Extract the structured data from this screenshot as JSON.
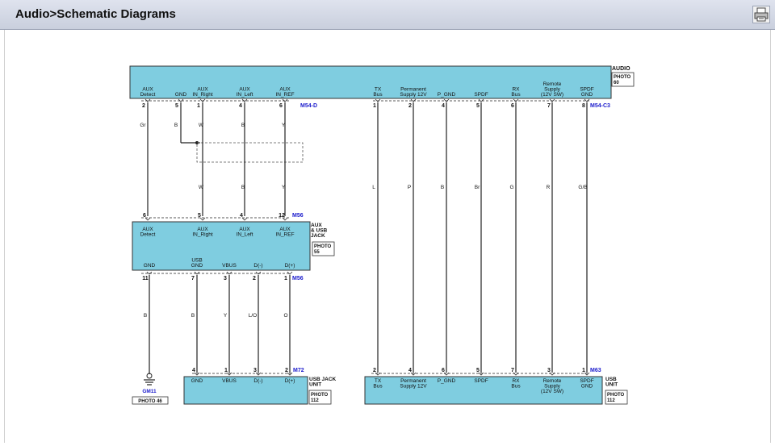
{
  "header": {
    "title": "Audio>Schematic Diagrams",
    "print_icon": "printer-icon"
  },
  "colors": {
    "connector_fill": "#7fcde0",
    "wire": "#222222",
    "connector_id": "#1a1acc"
  },
  "diagram": {
    "top_component": {
      "name": "AUDIO",
      "photo": "PHOTO\n60",
      "pins_left": [
        {
          "label": "AUX\nDetect",
          "num": "2"
        },
        {
          "label": "GND",
          "num": "5"
        },
        {
          "label": "AUX\nIN_Right",
          "num": "1"
        },
        {
          "label": "AUX\nIN_Left",
          "num": "4"
        },
        {
          "label": "AUX\nIN_REF",
          "num": "6"
        }
      ],
      "connector_left": "M54-D",
      "pins_right": [
        {
          "label": "TX\nBus",
          "num": "1"
        },
        {
          "label": "Permanent\nSupply 12V",
          "num": "2"
        },
        {
          "label": "P_GND",
          "num": "4"
        },
        {
          "label": "SPDF",
          "num": "5"
        },
        {
          "label": "RX\nBus",
          "num": "6"
        },
        {
          "label": "Remote\nSupply\n(12V SW)",
          "num": "7"
        },
        {
          "label": "SPDF\nGND",
          "num": "8"
        }
      ],
      "connector_right": "M54-C3"
    },
    "wires_top_left": {
      "upper_colors": [
        "Gr",
        "B",
        "W",
        "B",
        "Y"
      ],
      "lower_colors": [
        "W",
        "B",
        "Y"
      ]
    },
    "wires_right": [
      "L",
      "P",
      "B",
      "Br",
      "G",
      "R",
      "G/B"
    ],
    "aux_usb_jack": {
      "name": "AUX\n& USB\nJACK",
      "photo": "PHOTO\n55",
      "top_connector": "M56",
      "top_pins": [
        {
          "label": "AUX\nDetect",
          "num": "6"
        },
        {
          "label": "AUX\nIN_Right",
          "num": "5"
        },
        {
          "label": "AUX\nIN_Left",
          "num": "4"
        },
        {
          "label": "AUX\nIN_REF",
          "num": "12"
        }
      ],
      "bottom_connector": "M56",
      "bottom_pins": [
        {
          "label": "GND",
          "num": "11"
        },
        {
          "label": "USB\nGND",
          "num": "7"
        },
        {
          "label": "VBUS",
          "num": "3"
        },
        {
          "label": "D(-)",
          "num": "2"
        },
        {
          "label": "D(+)",
          "num": "1"
        }
      ]
    },
    "lower_wire_colors": [
      "B",
      "B",
      "Y",
      "L/O",
      "O"
    ],
    "ground": {
      "name": "GM11",
      "photo": "PHOTO 46"
    },
    "usb_jack_unit": {
      "name": "USB JACK\nUNIT",
      "photo": "PHOTO\n112",
      "connector": "M72",
      "pins": [
        {
          "label": "GND",
          "num": "4"
        },
        {
          "label": "VBUS",
          "num": "1"
        },
        {
          "label": "D(-)",
          "num": "3"
        },
        {
          "label": "D(+)",
          "num": "2"
        }
      ]
    },
    "usb_unit": {
      "name": "USB\nUNIT",
      "photo": "PHOTO\n112",
      "connector": "M63",
      "pins": [
        {
          "label": "TX\nBus",
          "num": "2"
        },
        {
          "label": "Permanent\nSupply 12V",
          "num": "4"
        },
        {
          "label": "P_GND",
          "num": "6"
        },
        {
          "label": "SPDF",
          "num": "5"
        },
        {
          "label": "RX\nBus",
          "num": "7"
        },
        {
          "label": "Remote\nSupply\n(12V SW)",
          "num": "3"
        },
        {
          "label": "SPDF\nGND",
          "num": "1"
        }
      ]
    }
  }
}
